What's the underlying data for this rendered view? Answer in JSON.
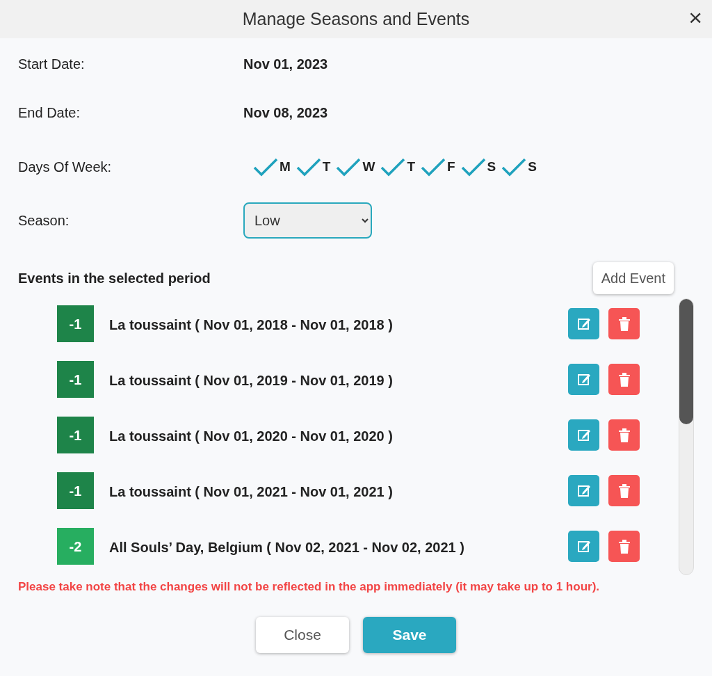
{
  "dialog": {
    "title": "Manage Seasons and Events",
    "close": "×"
  },
  "fields": [
    {
      "label": "Start Date:",
      "value": "Nov 01, 2023"
    },
    {
      "label": "End Date:",
      "value": "Nov 08, 2023"
    }
  ],
  "days_of_week": {
    "label": "Days Of Week:",
    "days": [
      {
        "label": "M",
        "checked": true
      },
      {
        "label": "T",
        "checked": true
      },
      {
        "label": "W",
        "checked": true
      },
      {
        "label": "T",
        "checked": true
      },
      {
        "label": "F",
        "checked": true
      },
      {
        "label": "S",
        "checked": true
      },
      {
        "label": "S",
        "checked": true
      }
    ]
  },
  "season": {
    "label": "Season:",
    "value": "Low"
  },
  "events": {
    "heading": "Events in the selected period",
    "add_button": "Add Event",
    "items": [
      {
        "badge": "-1",
        "color": "#1e8449",
        "text": "La toussaint ( Nov 01, 2018 - Nov 01, 2018 )"
      },
      {
        "badge": "-1",
        "color": "#1e8449",
        "text": "La toussaint ( Nov 01, 2019 - Nov 01, 2019 )"
      },
      {
        "badge": "-1",
        "color": "#1e8449",
        "text": "La toussaint ( Nov 01, 2020 - Nov 01, 2020 )"
      },
      {
        "badge": "-1",
        "color": "#1e8449",
        "text": "La toussaint ( Nov 01, 2021 - Nov 01, 2021 )"
      },
      {
        "badge": "-2",
        "color": "#27ae60",
        "text": "All Souls’ Day, Belgium ( Nov 02, 2021 - Nov 02, 2021 )"
      }
    ]
  },
  "notice": "Please take note that the changes will not be reflected in the app immediately (it may take up to 1 hour).",
  "buttons": [
    {
      "label": "Close",
      "kind": "secondary"
    },
    {
      "label": "Save",
      "kind": "primary"
    }
  ]
}
